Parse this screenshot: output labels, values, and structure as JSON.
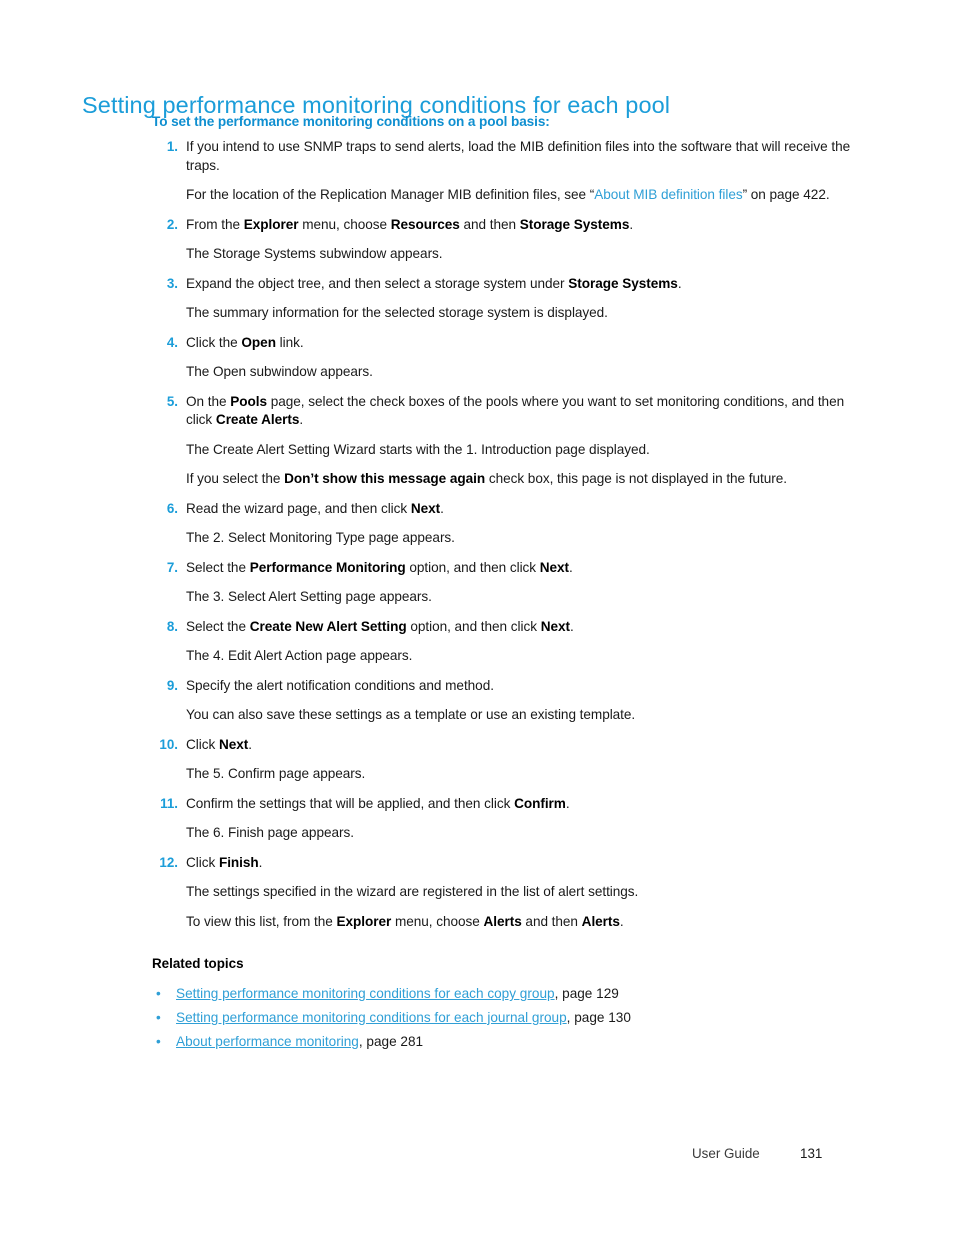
{
  "document": {
    "heading": "Setting performance monitoring conditions for each pool",
    "subheading": "To set the performance monitoring conditions on a pool basis:",
    "related_topics_title": "Related topics",
    "accent_color": "#1b9dd9",
    "link_color": "#2f9fd6",
    "body_color": "#1a1a1a"
  },
  "steps": [
    {
      "num": "1.",
      "segments": [
        {
          "type": "text",
          "text": "If you intend to use SNMP traps to send alerts, load the MIB definition files into the software that will receive the traps."
        }
      ],
      "notes": [
        {
          "segments": [
            {
              "type": "text",
              "text": "For the location of the Replication Manager MIB definition files, see “"
            },
            {
              "type": "link",
              "text": "About MIB definition files"
            },
            {
              "type": "text",
              "text": "” on page 422."
            }
          ]
        }
      ]
    },
    {
      "num": "2.",
      "segments": [
        {
          "type": "text",
          "text": "From the "
        },
        {
          "type": "bold",
          "text": "Explorer"
        },
        {
          "type": "text",
          "text": " menu, choose "
        },
        {
          "type": "bold",
          "text": "Resources"
        },
        {
          "type": "text",
          "text": " and then "
        },
        {
          "type": "bold",
          "text": "Storage Systems"
        },
        {
          "type": "text",
          "text": "."
        }
      ],
      "notes": [
        {
          "segments": [
            {
              "type": "text",
              "text": "The Storage Systems subwindow appears."
            }
          ]
        }
      ]
    },
    {
      "num": "3.",
      "segments": [
        {
          "type": "text",
          "text": "Expand the object tree, and then select a storage system under "
        },
        {
          "type": "bold",
          "text": "Storage Systems"
        },
        {
          "type": "text",
          "text": "."
        }
      ],
      "notes": [
        {
          "segments": [
            {
              "type": "text",
              "text": "The summary information for the selected storage system is displayed."
            }
          ]
        }
      ]
    },
    {
      "num": "4.",
      "segments": [
        {
          "type": "text",
          "text": "Click the "
        },
        {
          "type": "bold",
          "text": "Open"
        },
        {
          "type": "text",
          "text": " link."
        }
      ],
      "notes": [
        {
          "segments": [
            {
              "type": "text",
              "text": "The Open subwindow appears."
            }
          ]
        }
      ]
    },
    {
      "num": "5.",
      "segments": [
        {
          "type": "text",
          "text": "On the "
        },
        {
          "type": "bold",
          "text": "Pools"
        },
        {
          "type": "text",
          "text": " page, select the check boxes of the pools where you want to set monitoring conditions, and then click "
        },
        {
          "type": "bold",
          "text": "Create Alerts"
        },
        {
          "type": "text",
          "text": "."
        }
      ],
      "notes": [
        {
          "segments": [
            {
              "type": "text",
              "text": "The Create Alert Setting Wizard starts with the 1. Introduction page displayed."
            }
          ]
        },
        {
          "segments": [
            {
              "type": "text",
              "text": "If you select the "
            },
            {
              "type": "bold",
              "text": "Don’t show this message again"
            },
            {
              "type": "text",
              "text": " check box, this page is not displayed in the future."
            }
          ]
        }
      ]
    },
    {
      "num": "6.",
      "segments": [
        {
          "type": "text",
          "text": "Read the wizard page, and then click "
        },
        {
          "type": "bold",
          "text": "Next"
        },
        {
          "type": "text",
          "text": "."
        }
      ],
      "notes": [
        {
          "segments": [
            {
              "type": "text",
              "text": "The 2. Select Monitoring Type page appears."
            }
          ]
        }
      ]
    },
    {
      "num": "7.",
      "segments": [
        {
          "type": "text",
          "text": "Select the "
        },
        {
          "type": "bold",
          "text": "Performance Monitoring"
        },
        {
          "type": "text",
          "text": " option, and then click "
        },
        {
          "type": "bold",
          "text": "Next"
        },
        {
          "type": "text",
          "text": "."
        }
      ],
      "notes": [
        {
          "segments": [
            {
              "type": "text",
              "text": "The 3. Select Alert Setting page appears."
            }
          ]
        }
      ]
    },
    {
      "num": "8.",
      "segments": [
        {
          "type": "text",
          "text": "Select the "
        },
        {
          "type": "bold",
          "text": "Create New Alert Setting"
        },
        {
          "type": "text",
          "text": " option, and then click "
        },
        {
          "type": "bold",
          "text": "Next"
        },
        {
          "type": "text",
          "text": "."
        }
      ],
      "notes": [
        {
          "segments": [
            {
              "type": "text",
              "text": "The 4. Edit Alert Action page appears."
            }
          ]
        }
      ]
    },
    {
      "num": "9.",
      "segments": [
        {
          "type": "text",
          "text": "Specify the alert notification conditions and method."
        }
      ],
      "notes": [
        {
          "segments": [
            {
              "type": "text",
              "text": "You can also save these settings as a template or use an existing template."
            }
          ]
        }
      ]
    },
    {
      "num": "10.",
      "segments": [
        {
          "type": "text",
          "text": "Click "
        },
        {
          "type": "bold",
          "text": "Next"
        },
        {
          "type": "text",
          "text": "."
        }
      ],
      "notes": [
        {
          "segments": [
            {
              "type": "text",
              "text": "The 5. Confirm page appears."
            }
          ]
        }
      ]
    },
    {
      "num": "11.",
      "segments": [
        {
          "type": "text",
          "text": "Confirm the settings that will be applied, and then click "
        },
        {
          "type": "bold",
          "text": "Confirm"
        },
        {
          "type": "text",
          "text": "."
        }
      ],
      "notes": [
        {
          "segments": [
            {
              "type": "text",
              "text": "The 6. Finish page appears."
            }
          ]
        }
      ]
    },
    {
      "num": "12.",
      "segments": [
        {
          "type": "text",
          "text": "Click "
        },
        {
          "type": "bold",
          "text": "Finish"
        },
        {
          "type": "text",
          "text": "."
        }
      ],
      "notes": [
        {
          "segments": [
            {
              "type": "text",
              "text": "The settings specified in the wizard are registered in the list of alert settings."
            }
          ]
        },
        {
          "segments": [
            {
              "type": "text",
              "text": "To view this list, from the "
            },
            {
              "type": "bold",
              "text": "Explorer"
            },
            {
              "type": "text",
              "text": " menu, choose "
            },
            {
              "type": "bold",
              "text": "Alerts"
            },
            {
              "type": "text",
              "text": " and then "
            },
            {
              "type": "bold",
              "text": "Alerts"
            },
            {
              "type": "text",
              "text": "."
            }
          ]
        }
      ]
    }
  ],
  "related_topics": [
    {
      "bullet": "•",
      "link": "Setting performance monitoring conditions for each copy group",
      "page": ", page 129"
    },
    {
      "bullet": "•",
      "link": "Setting performance monitoring conditions for each journal group",
      "page": ", page 130"
    },
    {
      "bullet": "•",
      "link": "About performance monitoring",
      "page": ", page 281"
    }
  ],
  "footer": {
    "label": "User Guide",
    "page_number": "131"
  }
}
